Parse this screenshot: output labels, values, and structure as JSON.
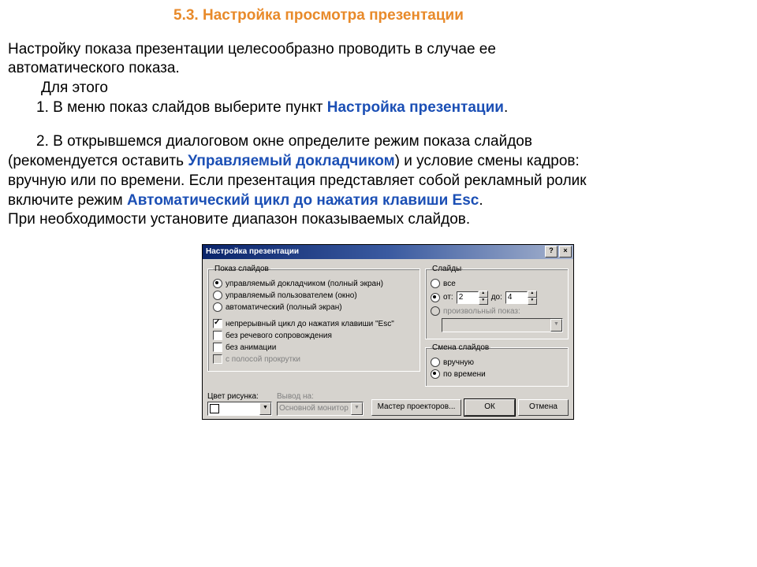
{
  "heading": "5.3.  Настройка просмотра презентации",
  "intro_line1": "Настройку показа презентации целесообразно проводить в случае ее",
  "intro_line2": "автоматического показа.",
  "for_this": "Для этого",
  "step1_a": "1.  В меню показ слайдов выберите пункт ",
  "step1_k": "Настройка презентации",
  "step1_b": ".",
  "step2_a": "2.  В открывшемся диалоговом окне определите режим показа слайдов",
  "step2_line2a": "(рекомендуется оставить ",
  "step2_k1": "Управляемый докладчиком",
  "step2_line2b": ") и условие смены кадров:",
  "step2_line3": "вручную или по времени. Если презентация представляет собой рекламный ролик",
  "step2_line4a": "включите режим ",
  "step2_k2": "Автоматический цикл до нажатия клавиши Esc",
  "step2_line4b": ".",
  "step2_line5": "При необходимости установите диапазон  показываемых слайдов.",
  "dlg": {
    "title": "Настройка презентации",
    "help": "?",
    "close": "×",
    "group_show": {
      "legend": "Показ слайдов",
      "r1": "управляемый докладчиком (полный экран)",
      "r2": "управляемый пользователем (окно)",
      "r3": "автоматический (полный экран)",
      "c1": "непрерывный цикл до нажатия клавиши \"Esc\"",
      "c2": "без речевого сопровождения",
      "c3": "без анимации",
      "c4": "с полосой прокрутки"
    },
    "group_slides": {
      "legend": "Слайды",
      "r_all": "все",
      "r_from": "от:",
      "from_val": "2",
      "to_lbl": "до:",
      "to_val": "4",
      "r_custom": "произвольный показ:"
    },
    "group_advance": {
      "legend": "Смена слайдов",
      "r_manual": "вручную",
      "r_time": "по времени"
    },
    "pen_color": "Цвет рисунка:",
    "output_on": "Вывод на:",
    "output_val": "Основной монитор",
    "btn_wizard": "Мастер проекторов...",
    "btn_ok": "ОК",
    "btn_cancel": "Отмена"
  }
}
